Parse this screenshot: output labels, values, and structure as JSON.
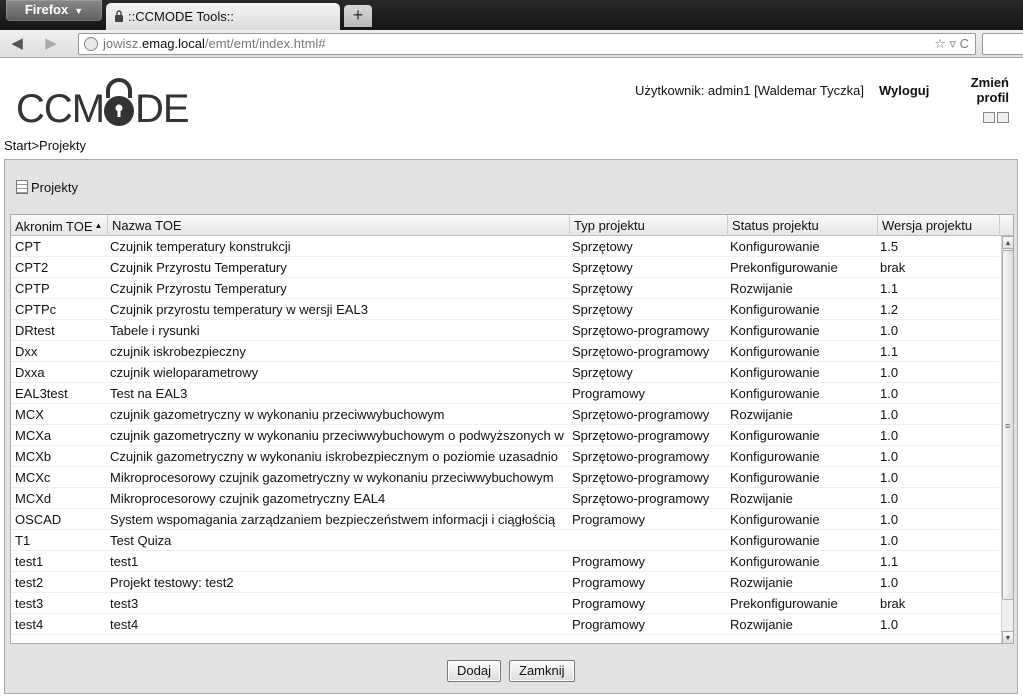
{
  "browser": {
    "app_button": "Firefox",
    "tab_title": "::CCMODE Tools::",
    "new_tab_label": "+",
    "url_prefix": "jowisz.",
    "url_host": "emag.local",
    "url_path": "/emt/emt/index.html#",
    "url_right_controls": "☆ ▿ C",
    "back_icon": "back-arrow-icon",
    "forward_icon": "forward-arrow-icon"
  },
  "header": {
    "logo_text_left": "CCM",
    "logo_text_right": "DE",
    "user_label": "Użytkownik: admin1 [Waldemar Tyczka]",
    "logout_label": "Wyloguj",
    "change_profile_label": "Zmień profil"
  },
  "breadcrumb": "Start>Projekty",
  "panel": {
    "title": "Projekty",
    "columns": [
      "Akronim TOE",
      "Nazwa TOE",
      "Typ projektu",
      "Status projektu",
      "Wersja projektu"
    ],
    "sort_indicator": "▲",
    "rows": [
      [
        "CPT",
        "Czujnik temperatury konstrukcji",
        "Sprzętowy",
        "Konfigurowanie",
        "1.5"
      ],
      [
        "CPT2",
        "Czujnik Przyrostu Temperatury",
        "Sprzętowy",
        "Prekonfigurowanie",
        "brak"
      ],
      [
        "CPTP",
        "Czujnik Przyrostu Temperatury",
        "Sprzętowy",
        "Rozwijanie",
        "1.1"
      ],
      [
        "CPTPc",
        "Czujnik przyrostu temperatury w wersji EAL3",
        "Sprzętowy",
        "Konfigurowanie",
        "1.2"
      ],
      [
        "DRtest",
        "Tabele i rysunki",
        "Sprzętowo-programowy",
        "Konfigurowanie",
        "1.0"
      ],
      [
        "Dxx",
        "czujnik iskrobezpieczny",
        "Sprzętowo-programowy",
        "Konfigurowanie",
        "1.1"
      ],
      [
        "Dxxa",
        "czujnik wieloparametrowy",
        "Sprzętowy",
        "Konfigurowanie",
        "1.0"
      ],
      [
        "EAL3test",
        "Test na EAL3",
        "Programowy",
        "Konfigurowanie",
        "1.0"
      ],
      [
        "MCX",
        "czujnik gazometryczny w wykonaniu przeciwwybuchowym",
        "Sprzętowo-programowy",
        "Rozwijanie",
        "1.0"
      ],
      [
        "MCXa",
        "czujnik gazometryczny w wykonaniu przeciwwybuchowym o podwyższonych w",
        "Sprzętowo-programowy",
        "Konfigurowanie",
        "1.0"
      ],
      [
        "MCXb",
        "Czujnik gazometryczny w wykonaniu iskrobezpiecznym o poziomie uzasadnio",
        "Sprzętowo-programowy",
        "Konfigurowanie",
        "1.0"
      ],
      [
        "MCXc",
        "Mikroprocesorowy czujnik gazometryczny w wykonaniu przeciwwybuchowym",
        "Sprzętowo-programowy",
        "Konfigurowanie",
        "1.0"
      ],
      [
        "MCXd",
        "Mikroprocesorowy czujnik gazometryczny EAL4",
        "Sprzętowo-programowy",
        "Rozwijanie",
        "1.0"
      ],
      [
        "OSCAD",
        "System wspomagania zarządzaniem bezpieczeństwem informacji i ciągłością",
        "Programowy",
        "Konfigurowanie",
        "1.0"
      ],
      [
        "T1",
        "Test Quiza",
        "",
        "Konfigurowanie",
        "1.0"
      ],
      [
        "test1",
        "test1",
        "Programowy",
        "Konfigurowanie",
        "1.1"
      ],
      [
        "test2",
        "Projekt testowy: test2",
        "Programowy",
        "Rozwijanie",
        "1.0"
      ],
      [
        "test3",
        "test3",
        "Programowy",
        "Prekonfigurowanie",
        "brak"
      ],
      [
        "test4",
        "test4",
        "Programowy",
        "Rozwijanie",
        "1.0"
      ]
    ],
    "add_button": "Dodaj",
    "close_button": "Zamknij"
  }
}
